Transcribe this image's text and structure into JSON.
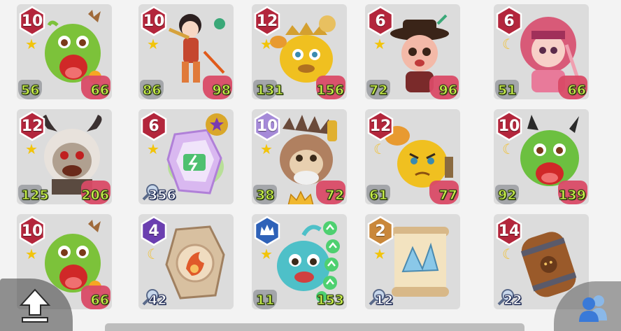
{
  "cards": [
    {
      "level": "10",
      "badge": "red",
      "rank": "star",
      "atk": "56",
      "def": "66",
      "subject": "green-dragon-monster"
    },
    {
      "level": "10",
      "badge": "red",
      "rank": "star",
      "atk": "86",
      "def": "98",
      "subject": "warrior-girl"
    },
    {
      "level": "12",
      "badge": "red",
      "rank": "star",
      "atk": "131",
      "def": "156",
      "subject": "crowned-crab"
    },
    {
      "level": "6",
      "badge": "red",
      "rank": "star",
      "atk": "72",
      "def": "96",
      "subject": "hat-musician"
    },
    {
      "level": "6",
      "badge": "red",
      "rank": "moon",
      "atk": "51",
      "def": "66",
      "subject": "pink-girl"
    },
    {
      "level": "12",
      "badge": "red",
      "rank": "star",
      "atk": "125",
      "def": "206",
      "subject": "horned-beast"
    },
    {
      "level": "6",
      "badge": "red",
      "rank": "star",
      "single": "356",
      "subject": "lightning-crystal"
    },
    {
      "level": "10",
      "badge": "purple-light",
      "rank": "star",
      "atk": "38",
      "def": "72",
      "subject": "spiked-king"
    },
    {
      "level": "12",
      "badge": "red",
      "rank": "moon",
      "atk": "61",
      "def": "77",
      "subject": "angry-crab"
    },
    {
      "level": "10",
      "badge": "red",
      "rank": "moon",
      "atk": "92",
      "def": "139",
      "subject": "green-horned-monster"
    },
    {
      "level": "10",
      "badge": "red",
      "rank": "star",
      "atk": "",
      "def": "66",
      "subject": "green-dragon-monster"
    },
    {
      "level": "4",
      "badge": "purple",
      "rank": "moon",
      "single": "42",
      "subject": "fire-rune-stone"
    },
    {
      "level": "",
      "badge": "blue-crown",
      "rank": "star",
      "atk": "11",
      "def": "153",
      "subject": "blue-fish-monster"
    },
    {
      "level": "2",
      "badge": "orange",
      "rank": "star",
      "single": "12",
      "subject": "crystal-scroll"
    },
    {
      "level": "14",
      "badge": "red",
      "rank": "moon",
      "single": "22",
      "subject": "wooden-barrel"
    }
  ],
  "colors": {
    "badge_red": "#b3263c",
    "badge_purple": "#6b3fb0",
    "badge_purple_light": "#a58ad8",
    "badge_blue": "#2f62b8",
    "badge_orange": "#c9873a",
    "stat_green": "#c9ef4a",
    "def_pink": "#d94a66"
  },
  "buttons": {
    "upload": "upload-arrow-icon",
    "friends": "friends-icon"
  }
}
